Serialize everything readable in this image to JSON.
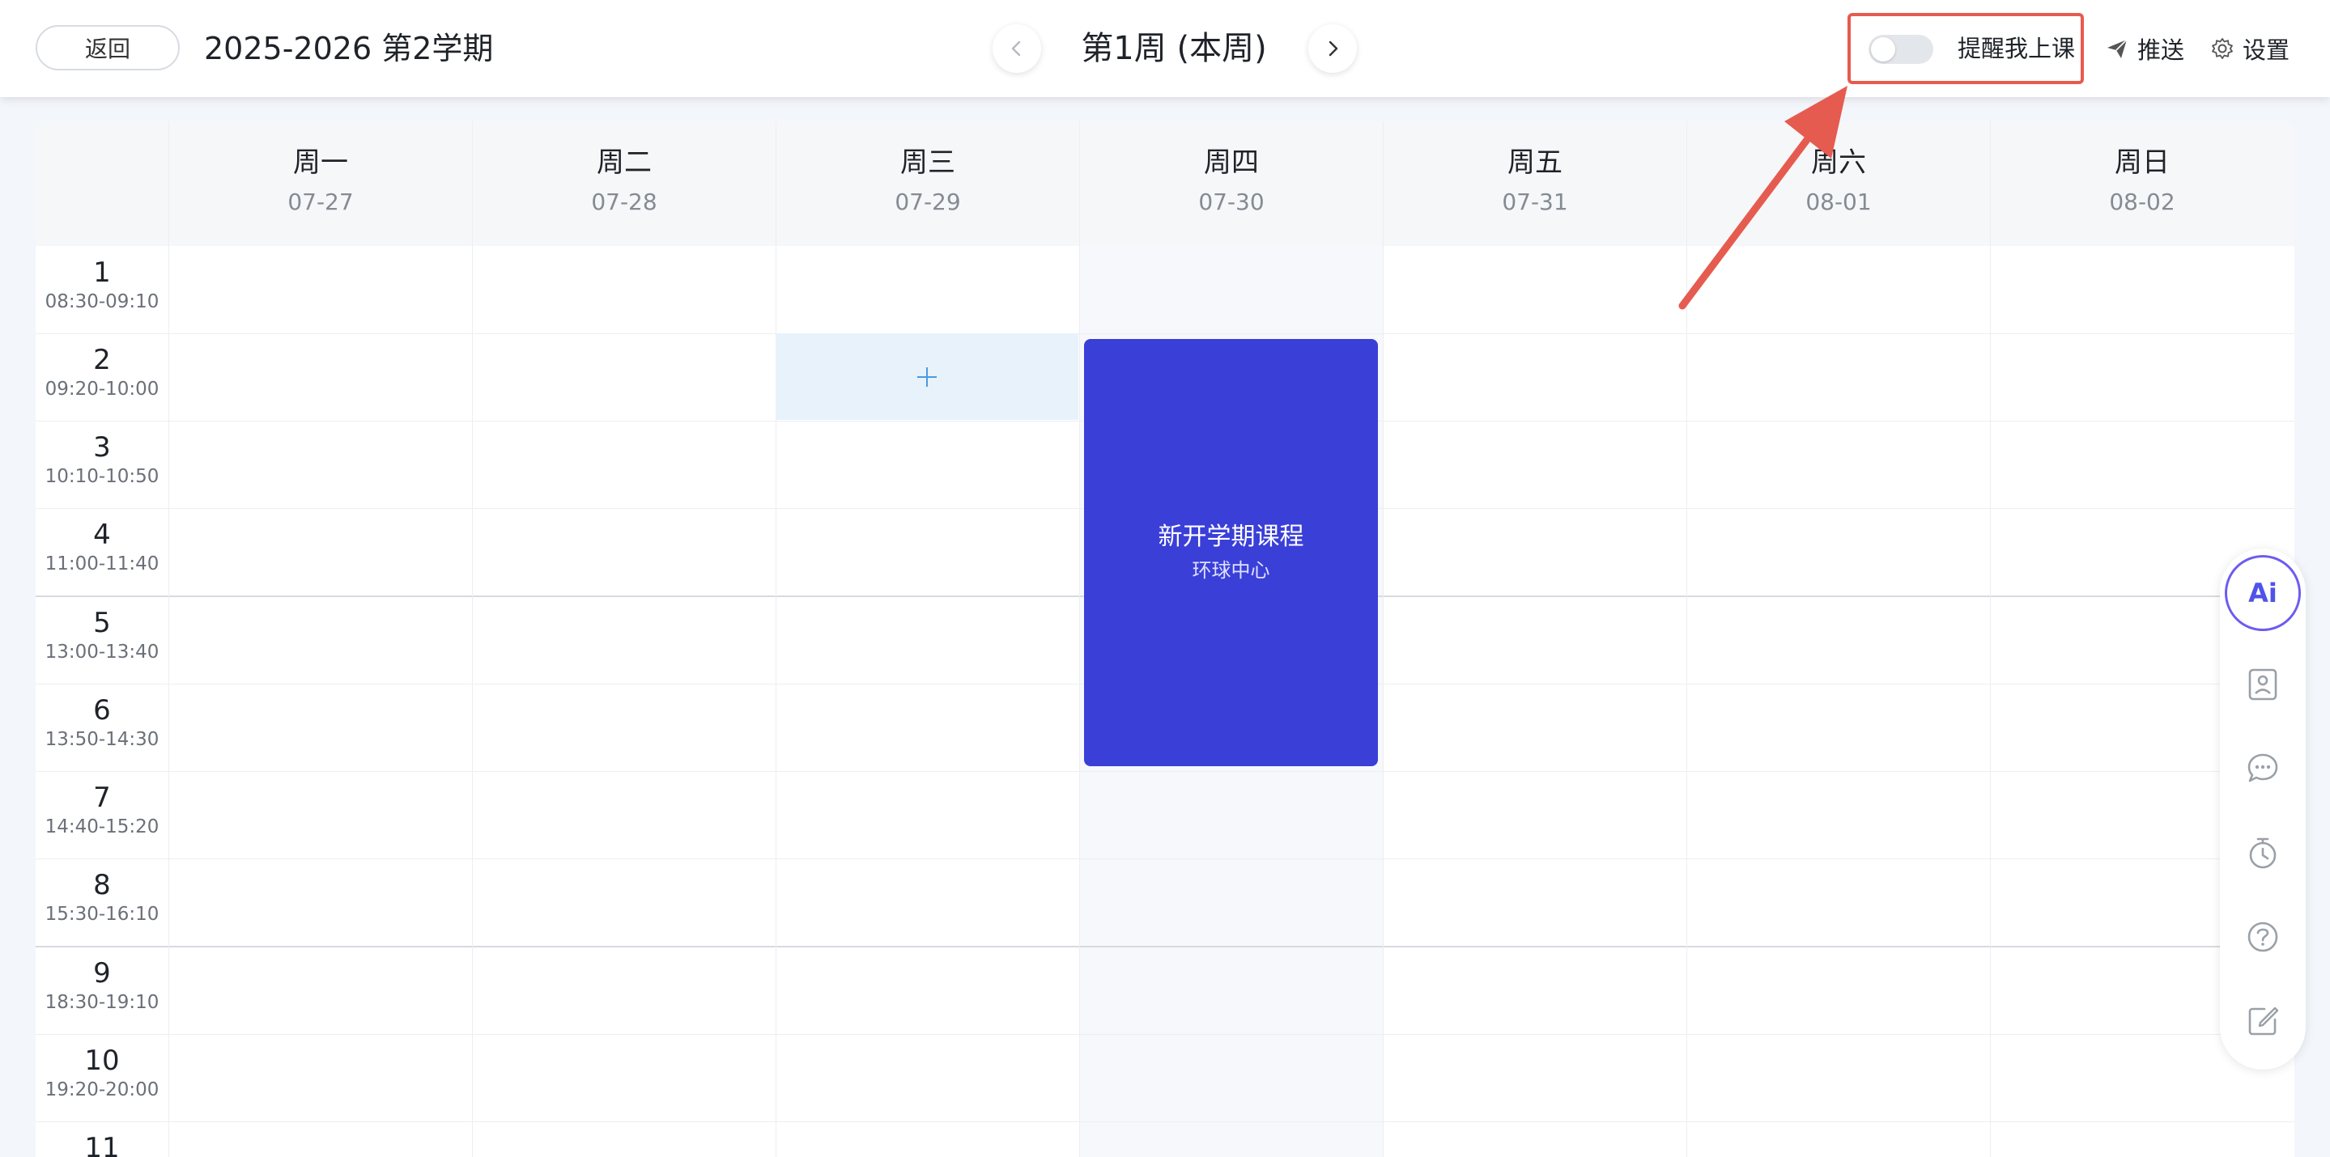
{
  "header": {
    "back_label": "返回",
    "term_title": "2025-2026 第2学期",
    "week_title": "第1周 (本周)",
    "remind_label": "提醒我上课",
    "remind_enabled": false,
    "push_label": "推送",
    "settings_label": "设置"
  },
  "days": [
    {
      "name": "周一",
      "date": "07-27"
    },
    {
      "name": "周二",
      "date": "07-28"
    },
    {
      "name": "周三",
      "date": "07-29"
    },
    {
      "name": "周四",
      "date": "07-30"
    },
    {
      "name": "周五",
      "date": "07-31"
    },
    {
      "name": "周六",
      "date": "08-01"
    },
    {
      "name": "周日",
      "date": "08-02"
    }
  ],
  "periods": [
    {
      "num": "1",
      "time": "08:30-09:10"
    },
    {
      "num": "2",
      "time": "09:20-10:00"
    },
    {
      "num": "3",
      "time": "10:10-10:50"
    },
    {
      "num": "4",
      "time": "11:00-11:40"
    },
    {
      "num": "5",
      "time": "13:00-13:40"
    },
    {
      "num": "6",
      "time": "13:50-14:30"
    },
    {
      "num": "7",
      "time": "14:40-15:20"
    },
    {
      "num": "8",
      "time": "15:30-16:10"
    },
    {
      "num": "9",
      "time": "18:30-19:10"
    },
    {
      "num": "10",
      "time": "19:20-20:00"
    },
    {
      "num": "11",
      "time": ""
    }
  ],
  "course": {
    "name": "新开学期课程",
    "location": "环球中心",
    "day": "周四",
    "periods": "2-6",
    "color": "#3a3fd8"
  },
  "add_cell": {
    "day": "周三",
    "period": "2",
    "icon": "plus-icon"
  },
  "toolbar": {
    "ai_label": "Ai",
    "items": [
      "contact-card-icon",
      "chat-icon",
      "timer-icon",
      "help-icon",
      "edit-icon"
    ]
  },
  "annotation": {
    "color": "#e65b4f"
  }
}
